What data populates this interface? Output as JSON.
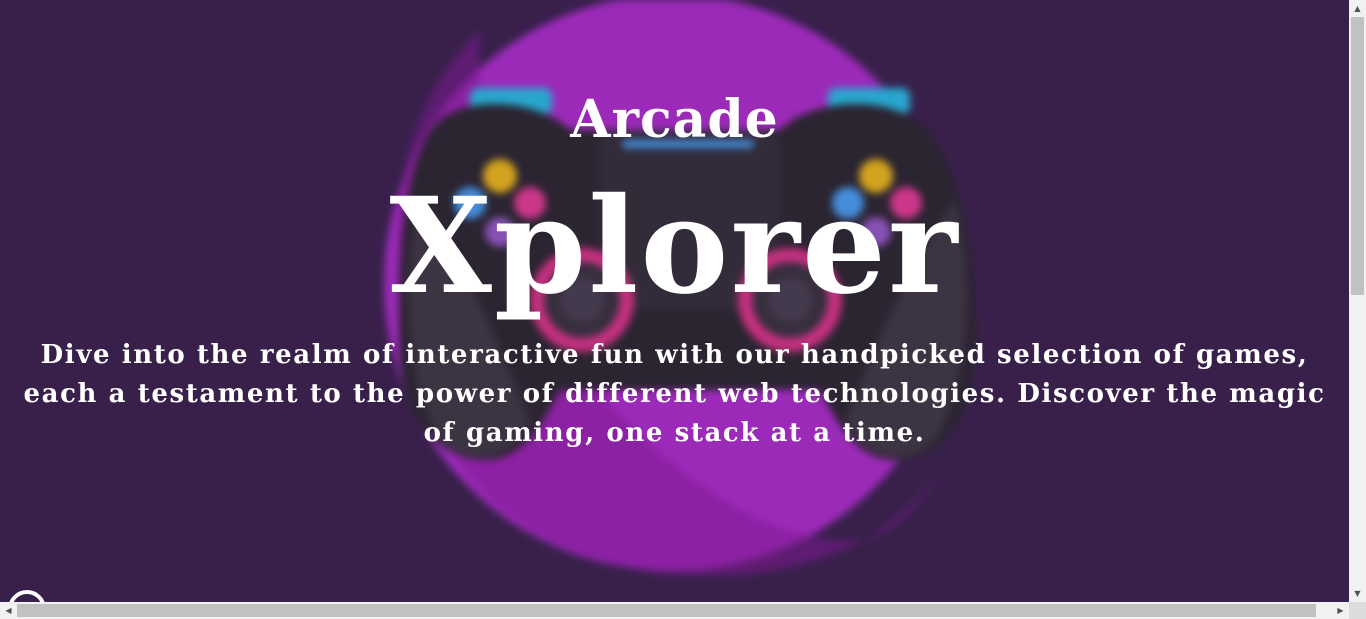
{
  "hero": {
    "title_small": "Arcade",
    "title_big": "Xplorer",
    "description": "Dive into the realm of interactive fun with our handpicked selection of games, each a testament to the power of different web technologies. Discover the magic of gaming, one stack at a time."
  },
  "background_image": {
    "icon": "gamepad-icon",
    "colors": {
      "page_background": "#3b2350",
      "circle": "#b52fd6",
      "circle_shadow": "#8f1ca6",
      "controller_body": "#2b2830",
      "controller_grip": "#403a46",
      "bumper": "#29c6f0",
      "button_yellow": "#f7c21a",
      "button_pink": "#f03d9c",
      "button_blue": "#4aa8ff",
      "stick_ring": "#e8368f"
    }
  },
  "scrollbars": {
    "vertical": {
      "up_arrow": "▲",
      "down_arrow": "▼"
    },
    "horizontal": {
      "left_arrow": "◀",
      "right_arrow": "▶"
    }
  }
}
